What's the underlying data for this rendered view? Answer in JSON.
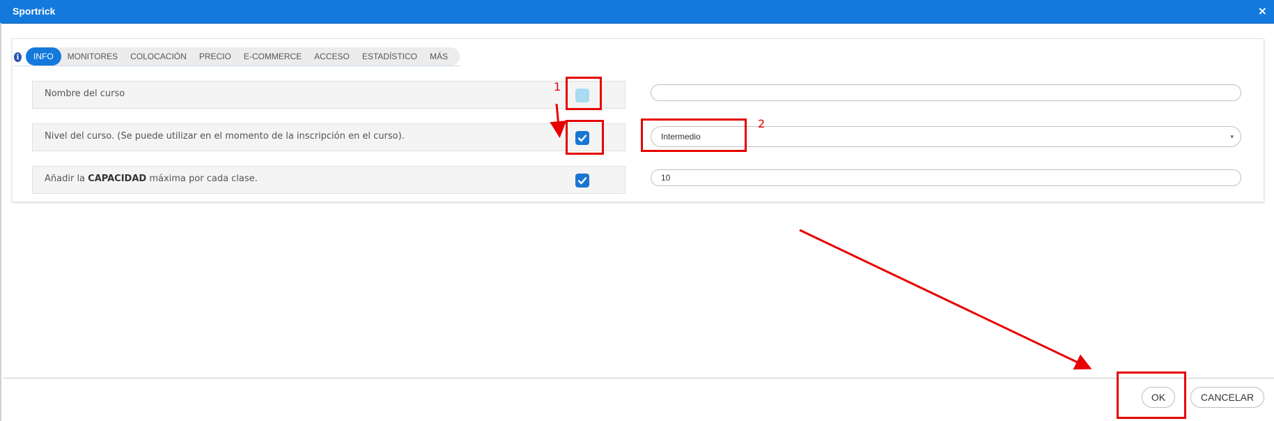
{
  "window": {
    "title": "Sportrick",
    "close_glyph": "×"
  },
  "tabs": [
    {
      "label": "INFO",
      "active": true
    },
    {
      "label": "MONITORES"
    },
    {
      "label": "COLOCACIÓN"
    },
    {
      "label": "PRECIO"
    },
    {
      "label": "E-COMMERCE"
    },
    {
      "label": "ACCESO"
    },
    {
      "label": "ESTADÍSTICO"
    },
    {
      "label": "MÁS"
    }
  ],
  "info_icon": {
    "glyph": "i",
    "name": "info-icon"
  },
  "rows": [
    {
      "label": "Nombre del curso",
      "checked": false,
      "value": ""
    },
    {
      "label": "Nivel del curso. (Se puede utilizar en el momento de la inscripción en el curso).",
      "checked": true,
      "value": "Intermedio",
      "type": "select"
    },
    {
      "label_pre": "Añadir la ",
      "label_bold": "CAPACIDAD",
      "label_post": " máxima por cada clase.",
      "checked": true,
      "value": "10"
    }
  ],
  "select_caret": "▾",
  "buttons": {
    "ok": "OK",
    "cancel": "CANCELAR"
  },
  "annotations": {
    "one": "1",
    "two": "2",
    "color": "#e60000"
  },
  "colors": {
    "titlebar": "#1479dc",
    "checkbox_on": "#1976d2",
    "checkbox_off": "#a8dcf2"
  }
}
